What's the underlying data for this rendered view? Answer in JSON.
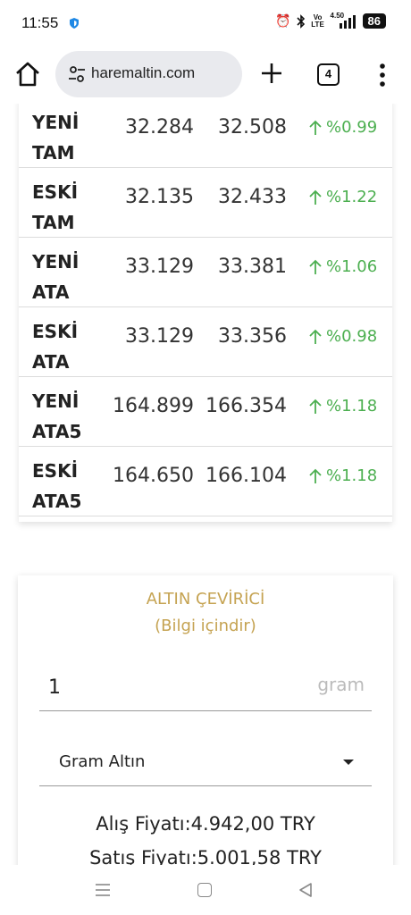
{
  "status_bar": {
    "time": "11:55",
    "battery": "86",
    "network": "Vo LTE",
    "net_speed": "4.50"
  },
  "browser": {
    "url": "haremaltin.com",
    "tab_count": "4"
  },
  "gold_table": {
    "rows": [
      {
        "name_line1": "YENİ",
        "name_line2": "TAM",
        "buy": "32.284",
        "sell": "32.508",
        "change": "%0.99"
      },
      {
        "name_line1": "ESKİ",
        "name_line2": "TAM",
        "buy": "32.135",
        "sell": "32.433",
        "change": "%1.22"
      },
      {
        "name_line1": "YENİ",
        "name_line2": "ATA",
        "buy": "33.129",
        "sell": "33.381",
        "change": "%1.06"
      },
      {
        "name_line1": "ESKİ",
        "name_line2": "ATA",
        "buy": "33.129",
        "sell": "33.356",
        "change": "%0.98"
      },
      {
        "name_line1": "YENİ",
        "name_line2": "ATA5",
        "buy": "164.899",
        "sell": "166.354",
        "change": "%1.18"
      },
      {
        "name_line1": "ESKİ",
        "name_line2": "ATA5",
        "buy": "164.650",
        "sell": "166.104",
        "change": "%1.18"
      }
    ],
    "change_color": "#4caf50"
  },
  "converter": {
    "title": "ALTIN ÇEVİRİCİ",
    "subtitle": "(Bilgi içindir)",
    "amount": "1",
    "unit": "gram",
    "selected_type": "Gram Altın",
    "buy_price": "Alış Fiyatı:4.942,00 TRY",
    "sell_price": "Satış Fiyatı:5.001,58 TRY",
    "accent_color": "#c5a352"
  }
}
